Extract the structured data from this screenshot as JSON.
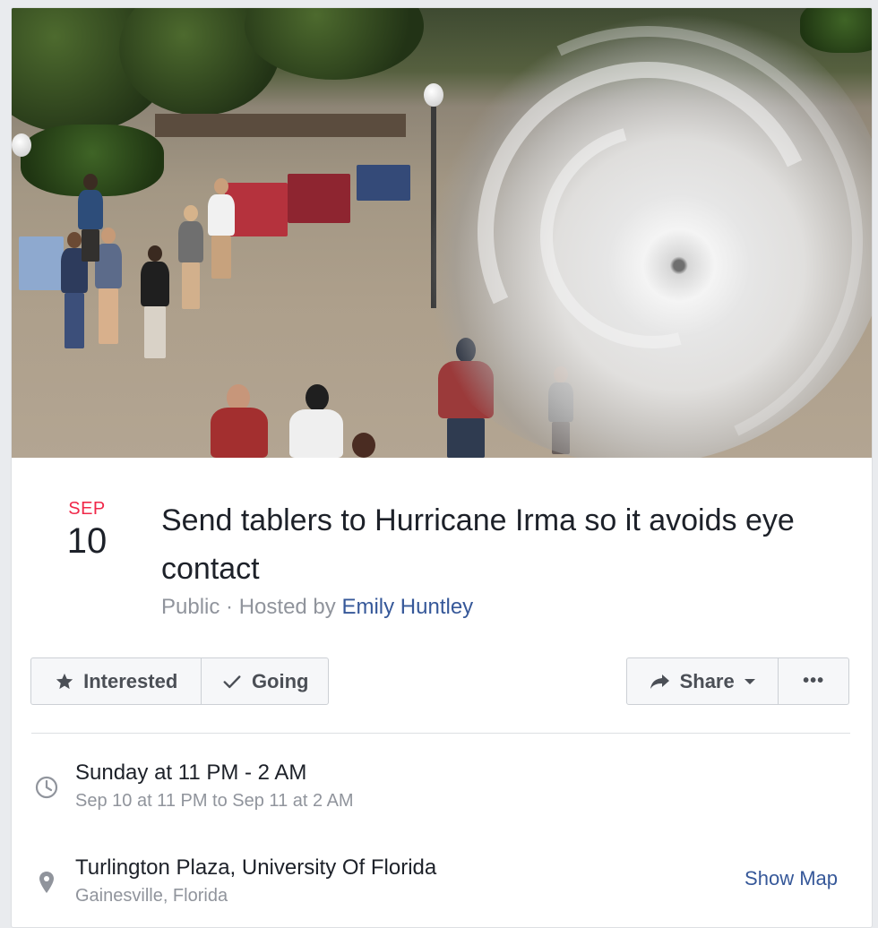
{
  "event": {
    "date": {
      "month": "SEP",
      "day": "10"
    },
    "title": "Send tablers to Hurricane Irma so it avoids eye contact",
    "privacy": "Public",
    "separator": "·",
    "hosted_by_label": "Hosted by",
    "host_name": "Emily Huntley"
  },
  "actions": {
    "interested": {
      "label": "Interested",
      "icon": "star-icon"
    },
    "going": {
      "label": "Going",
      "icon": "check-icon"
    },
    "share": {
      "label": "Share",
      "icon": "share-arrow-icon"
    },
    "more": {
      "label": "•••",
      "icon": "more-icon"
    }
  },
  "details": {
    "time": {
      "icon": "clock-icon",
      "primary": "Sunday at 11 PM - 2 AM",
      "secondary": "Sep 10 at 11 PM to Sep 11 at 2 AM"
    },
    "location": {
      "icon": "map-pin-icon",
      "primary": "Turlington Plaza, University Of Florida",
      "secondary": "Gainesville, Florida",
      "show_map_label": "Show Map"
    }
  },
  "colors": {
    "month": "#f02849",
    "link": "#365899",
    "muted": "#90949c",
    "text": "#1d2129",
    "button_bg": "#f6f7f9",
    "border": "#ccd0d5"
  }
}
